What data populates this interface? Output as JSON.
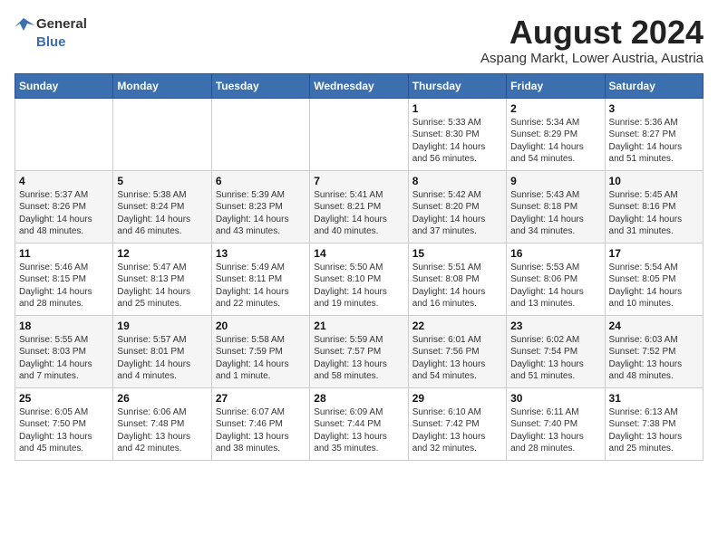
{
  "header": {
    "logo_general": "General",
    "logo_blue": "Blue",
    "month_title": "August 2024",
    "location": "Aspang Markt, Lower Austria, Austria"
  },
  "weekdays": [
    "Sunday",
    "Monday",
    "Tuesday",
    "Wednesday",
    "Thursday",
    "Friday",
    "Saturday"
  ],
  "weeks": [
    [
      {
        "day": "",
        "info": ""
      },
      {
        "day": "",
        "info": ""
      },
      {
        "day": "",
        "info": ""
      },
      {
        "day": "",
        "info": ""
      },
      {
        "day": "1",
        "info": "Sunrise: 5:33 AM\nSunset: 8:30 PM\nDaylight: 14 hours\nand 56 minutes."
      },
      {
        "day": "2",
        "info": "Sunrise: 5:34 AM\nSunset: 8:29 PM\nDaylight: 14 hours\nand 54 minutes."
      },
      {
        "day": "3",
        "info": "Sunrise: 5:36 AM\nSunset: 8:27 PM\nDaylight: 14 hours\nand 51 minutes."
      }
    ],
    [
      {
        "day": "4",
        "info": "Sunrise: 5:37 AM\nSunset: 8:26 PM\nDaylight: 14 hours\nand 48 minutes."
      },
      {
        "day": "5",
        "info": "Sunrise: 5:38 AM\nSunset: 8:24 PM\nDaylight: 14 hours\nand 46 minutes."
      },
      {
        "day": "6",
        "info": "Sunrise: 5:39 AM\nSunset: 8:23 PM\nDaylight: 14 hours\nand 43 minutes."
      },
      {
        "day": "7",
        "info": "Sunrise: 5:41 AM\nSunset: 8:21 PM\nDaylight: 14 hours\nand 40 minutes."
      },
      {
        "day": "8",
        "info": "Sunrise: 5:42 AM\nSunset: 8:20 PM\nDaylight: 14 hours\nand 37 minutes."
      },
      {
        "day": "9",
        "info": "Sunrise: 5:43 AM\nSunset: 8:18 PM\nDaylight: 14 hours\nand 34 minutes."
      },
      {
        "day": "10",
        "info": "Sunrise: 5:45 AM\nSunset: 8:16 PM\nDaylight: 14 hours\nand 31 minutes."
      }
    ],
    [
      {
        "day": "11",
        "info": "Sunrise: 5:46 AM\nSunset: 8:15 PM\nDaylight: 14 hours\nand 28 minutes."
      },
      {
        "day": "12",
        "info": "Sunrise: 5:47 AM\nSunset: 8:13 PM\nDaylight: 14 hours\nand 25 minutes."
      },
      {
        "day": "13",
        "info": "Sunrise: 5:49 AM\nSunset: 8:11 PM\nDaylight: 14 hours\nand 22 minutes."
      },
      {
        "day": "14",
        "info": "Sunrise: 5:50 AM\nSunset: 8:10 PM\nDaylight: 14 hours\nand 19 minutes."
      },
      {
        "day": "15",
        "info": "Sunrise: 5:51 AM\nSunset: 8:08 PM\nDaylight: 14 hours\nand 16 minutes."
      },
      {
        "day": "16",
        "info": "Sunrise: 5:53 AM\nSunset: 8:06 PM\nDaylight: 14 hours\nand 13 minutes."
      },
      {
        "day": "17",
        "info": "Sunrise: 5:54 AM\nSunset: 8:05 PM\nDaylight: 14 hours\nand 10 minutes."
      }
    ],
    [
      {
        "day": "18",
        "info": "Sunrise: 5:55 AM\nSunset: 8:03 PM\nDaylight: 14 hours\nand 7 minutes."
      },
      {
        "day": "19",
        "info": "Sunrise: 5:57 AM\nSunset: 8:01 PM\nDaylight: 14 hours\nand 4 minutes."
      },
      {
        "day": "20",
        "info": "Sunrise: 5:58 AM\nSunset: 7:59 PM\nDaylight: 14 hours\nand 1 minute."
      },
      {
        "day": "21",
        "info": "Sunrise: 5:59 AM\nSunset: 7:57 PM\nDaylight: 13 hours\nand 58 minutes."
      },
      {
        "day": "22",
        "info": "Sunrise: 6:01 AM\nSunset: 7:56 PM\nDaylight: 13 hours\nand 54 minutes."
      },
      {
        "day": "23",
        "info": "Sunrise: 6:02 AM\nSunset: 7:54 PM\nDaylight: 13 hours\nand 51 minutes."
      },
      {
        "day": "24",
        "info": "Sunrise: 6:03 AM\nSunset: 7:52 PM\nDaylight: 13 hours\nand 48 minutes."
      }
    ],
    [
      {
        "day": "25",
        "info": "Sunrise: 6:05 AM\nSunset: 7:50 PM\nDaylight: 13 hours\nand 45 minutes."
      },
      {
        "day": "26",
        "info": "Sunrise: 6:06 AM\nSunset: 7:48 PM\nDaylight: 13 hours\nand 42 minutes."
      },
      {
        "day": "27",
        "info": "Sunrise: 6:07 AM\nSunset: 7:46 PM\nDaylight: 13 hours\nand 38 minutes."
      },
      {
        "day": "28",
        "info": "Sunrise: 6:09 AM\nSunset: 7:44 PM\nDaylight: 13 hours\nand 35 minutes."
      },
      {
        "day": "29",
        "info": "Sunrise: 6:10 AM\nSunset: 7:42 PM\nDaylight: 13 hours\nand 32 minutes."
      },
      {
        "day": "30",
        "info": "Sunrise: 6:11 AM\nSunset: 7:40 PM\nDaylight: 13 hours\nand 28 minutes."
      },
      {
        "day": "31",
        "info": "Sunrise: 6:13 AM\nSunset: 7:38 PM\nDaylight: 13 hours\nand 25 minutes."
      }
    ]
  ]
}
